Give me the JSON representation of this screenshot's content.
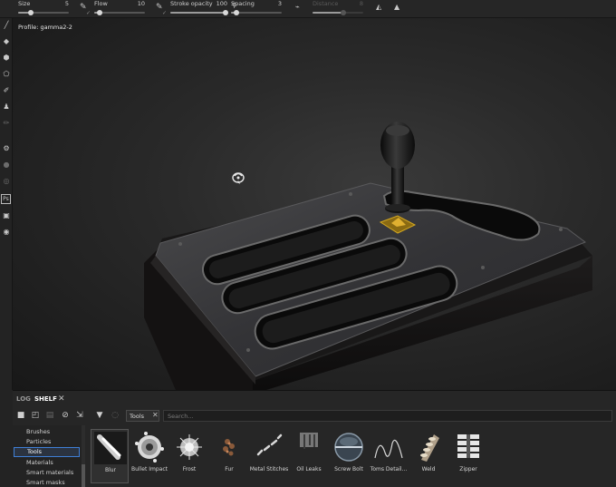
{
  "toolbar": {
    "size": {
      "label": "Size",
      "value": "5",
      "level": 0.25
    },
    "flow": {
      "label": "Flow",
      "value": "10",
      "level": 0.1
    },
    "stroke_opacity": {
      "label": "Stroke opacity",
      "value": "100",
      "level": 1.0
    },
    "spacing": {
      "label": "Spacing",
      "value": "3",
      "level": 0.1
    },
    "distance": {
      "label": "Distance",
      "value": "8",
      "level": 0.6,
      "disabled": true
    }
  },
  "viewport": {
    "profile_label": "Profile: gamma2-2"
  },
  "dock": {
    "tabs": [
      {
        "label": "LOG",
        "active": false
      },
      {
        "label": "SHELF",
        "active": true
      }
    ],
    "filter_chip": "Tools",
    "search_placeholder": "Search...",
    "categories": [
      {
        "label": "Brushes",
        "active": false
      },
      {
        "label": "Particles",
        "active": false
      },
      {
        "label": "Tools",
        "active": true
      },
      {
        "label": "Materials",
        "active": false
      },
      {
        "label": "Smart materials",
        "active": false
      },
      {
        "label": "Smart masks",
        "active": false
      }
    ],
    "items": [
      {
        "label": "Blur",
        "icon": "blur-icon",
        "selected": true
      },
      {
        "label": "Bullet Impact",
        "icon": "bullet-impact-icon",
        "selected": false
      },
      {
        "label": "Frost",
        "icon": "frost-icon",
        "selected": false
      },
      {
        "label": "Fur",
        "icon": "fur-icon",
        "selected": false
      },
      {
        "label": "Metal Stitches",
        "icon": "metal-stitches-icon",
        "selected": false
      },
      {
        "label": "Oil Leaks",
        "icon": "oil-leaks-icon",
        "selected": false
      },
      {
        "label": "Screw Bolt",
        "icon": "screw-bolt-icon",
        "selected": false
      },
      {
        "label": "Toms Detail...",
        "icon": "toms-detail-icon",
        "selected": false
      },
      {
        "label": "Weld",
        "icon": "weld-icon",
        "selected": false
      },
      {
        "label": "Zipper",
        "icon": "zipper-icon",
        "selected": false
      }
    ]
  },
  "colors": {
    "accent": "#3f7fd6",
    "panel_bg": "#262626",
    "viewport_bg": "#2a2a2a"
  }
}
